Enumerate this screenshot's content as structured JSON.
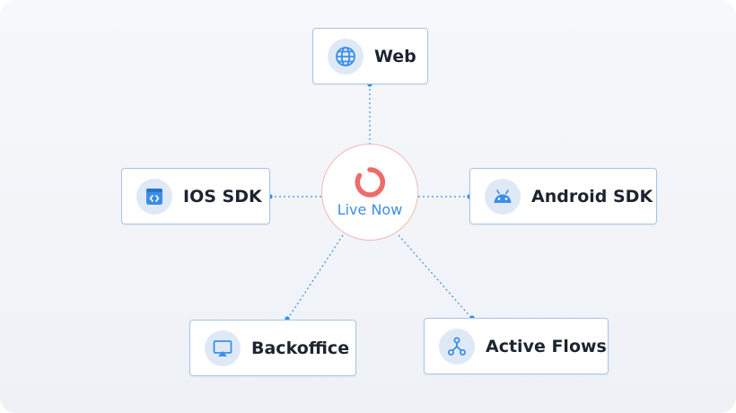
{
  "colors": {
    "connector": "#3b8ee8",
    "icon_bg": "#dfe9f6",
    "icon_fg": "#3b8ee8",
    "hub_logo": "#ee6b6b",
    "hub_text": "#3b8ee8",
    "node_border": "#a9c4e6"
  },
  "hub": {
    "label": "Live Now",
    "icon": "live-now-logo-icon"
  },
  "nodes": {
    "web": {
      "label": "Web",
      "icon": "globe-icon"
    },
    "ios": {
      "label": "IOS SDK",
      "icon": "code-window-icon"
    },
    "android": {
      "label": "Android SDK",
      "icon": "android-icon"
    },
    "backoffice": {
      "label": "Backoffice",
      "icon": "monitor-icon"
    },
    "flows": {
      "label": "Active Flows",
      "icon": "flow-branch-icon"
    }
  }
}
